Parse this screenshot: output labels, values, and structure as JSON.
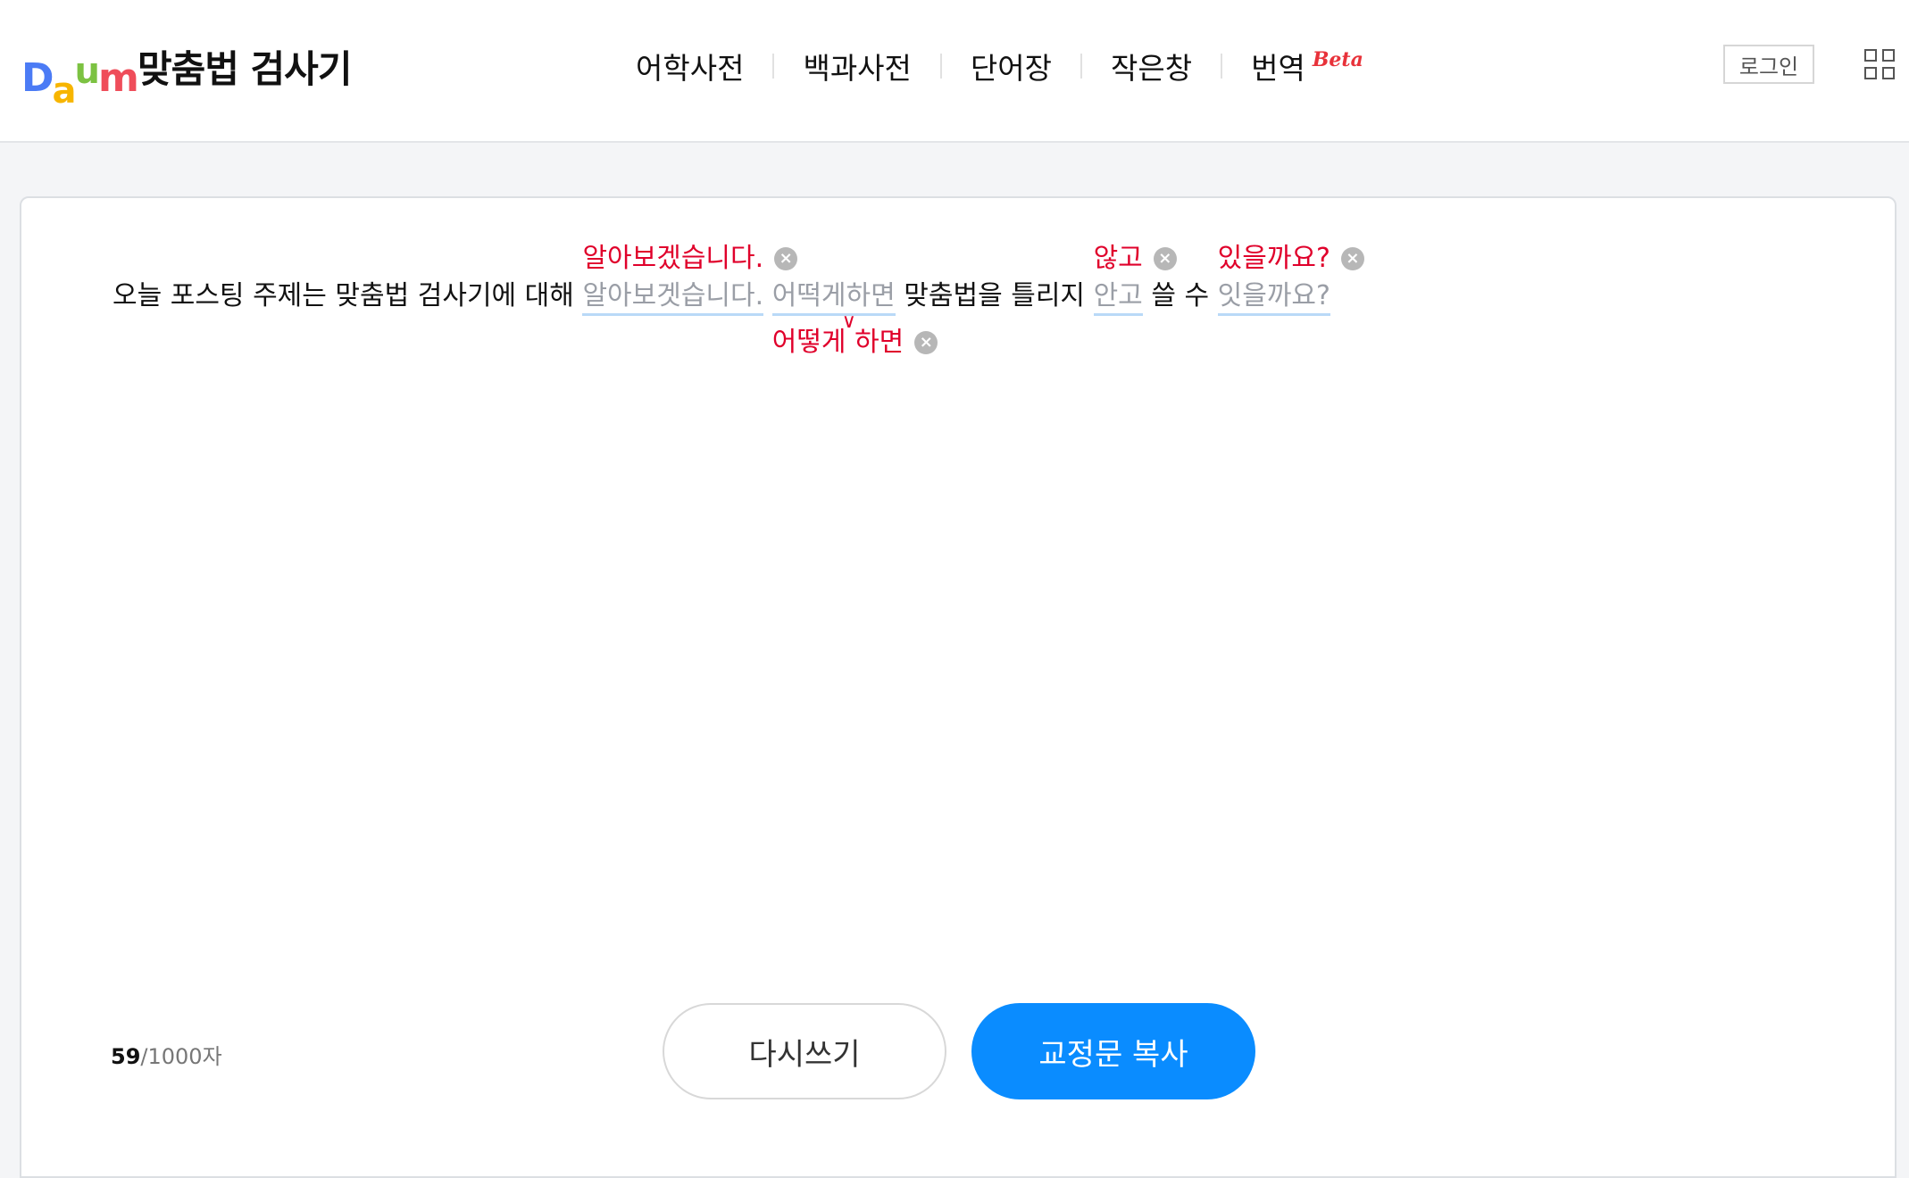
{
  "header": {
    "logo": {
      "parts": [
        "D",
        "a",
        "u",
        "m"
      ],
      "colors": [
        "#4b7bf5",
        "#f7b500",
        "#7cc242",
        "#ef4d5a"
      ]
    },
    "service_title": "맞춤법 검사기",
    "nav": [
      {
        "label": "어학사전"
      },
      {
        "label": "백과사전"
      },
      {
        "label": "단어장"
      },
      {
        "label": "작은창"
      },
      {
        "label": "번역",
        "badge": "Beta"
      }
    ],
    "login_label": "로그인",
    "apps_icon": "grid-icon"
  },
  "editor": {
    "segments": {
      "s1": "오늘 포스팅 주제는 맞춤법 검사기에 대해",
      "e1": "알아보겟습니다.",
      "e1_fix": "알아보겠습니다.",
      "e2": "어떡게하면",
      "e2_fix": "어떻게 하면",
      "s2": "맞춤법을 틀리지",
      "e3": "안고",
      "e3_fix": "않고",
      "s3": "쓸 수",
      "e4": "잇을까요?",
      "e4_fix": "있을까요?"
    },
    "suggestion_remove_icon": "close-circle-icon",
    "space_mark": "∨",
    "counter": {
      "current": "59",
      "max": "/1000자"
    },
    "buttons": {
      "reset": "다시쓰기",
      "copy": "교정문 복사"
    },
    "colors": {
      "error_text": "#9a9ea6",
      "suggestion": "#e0002b",
      "underline": "#b9d9f7",
      "primary": "#0a8cff"
    }
  }
}
